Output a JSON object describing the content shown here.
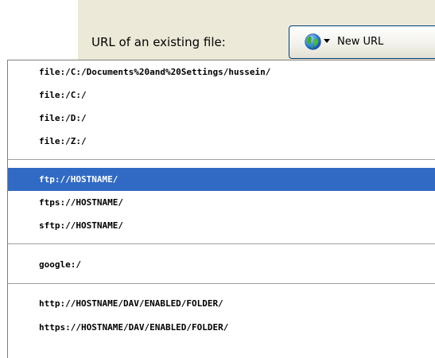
{
  "toolbar": {
    "url_label": "URL of an existing file:",
    "new_url_button": {
      "label": "New URL",
      "icon": "globe-icon",
      "dropdown_icon": "dropdown-arrow-icon"
    }
  },
  "url_menu": {
    "selected_item": "ftp://HOSTNAME/",
    "highlight_color": "#316ac5",
    "groups": [
      {
        "items": [
          "file:/C:/Documents%20and%20Settings/hussein/",
          "file:/C:/",
          "file:/D:/",
          "file:/Z:/"
        ]
      },
      {
        "items": [
          "ftp://HOSTNAME/",
          "ftps://HOSTNAME/",
          "sftp://HOSTNAME/"
        ]
      },
      {
        "items": [
          "google:/"
        ]
      },
      {
        "items": [
          "http://HOSTNAME/DAV/ENABLED/FOLDER/",
          "https://HOSTNAME/DAV/ENABLED/FOLDER/"
        ]
      }
    ]
  }
}
